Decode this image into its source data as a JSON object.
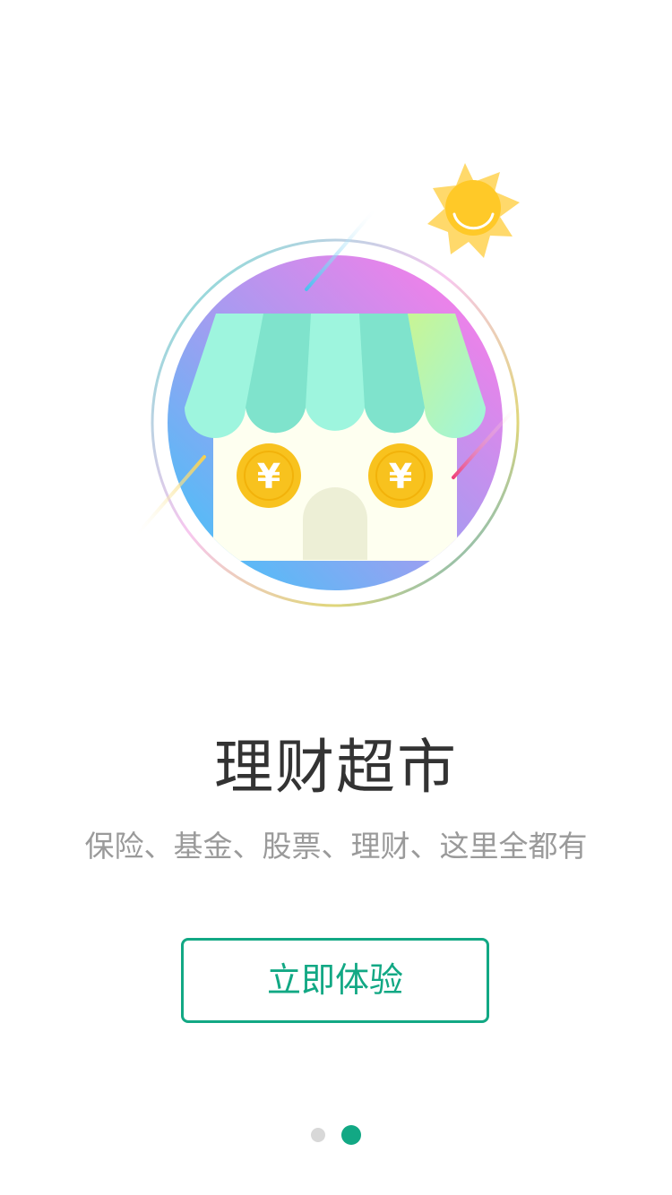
{
  "onboarding": {
    "title": "理财超市",
    "subtitle": "保险、基金、股票、理财、这里全都有",
    "cta_label": "立即体验",
    "coin_symbol": "¥",
    "page_count": 2,
    "active_page": 2
  },
  "colors": {
    "accent": "#12a884",
    "title": "#333333",
    "subtitle": "#9a9a9a",
    "coin": "#f8c21e",
    "sun": "#ffc928",
    "awning": "#8fe8d2",
    "house": "#fefff0"
  },
  "icons": {
    "illustration": "market-shop-illustration",
    "sun": "smiling-sun-icon",
    "coin": "yuan-coin-icon"
  }
}
